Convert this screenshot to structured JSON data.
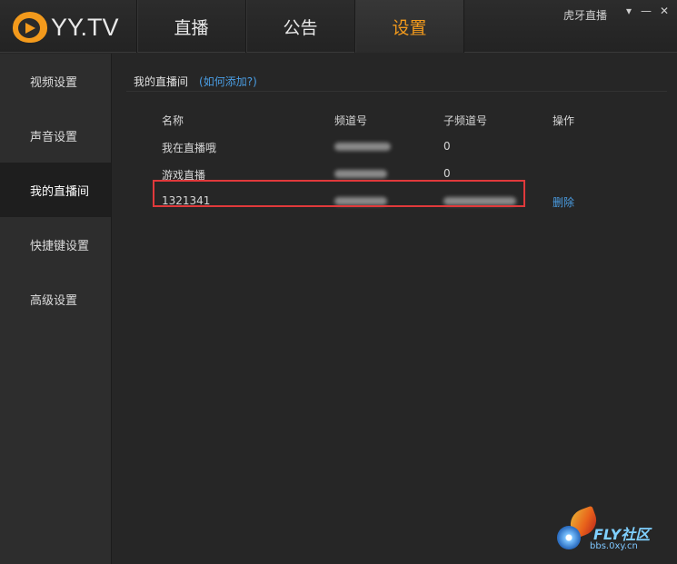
{
  "app": {
    "logo_text": "YY.TV",
    "label": "虎牙直播",
    "window_buttons": {
      "menu": "▾",
      "minimize": "—",
      "close": "✕"
    }
  },
  "tabs": [
    {
      "label": "直播",
      "active": false
    },
    {
      "label": "公告",
      "active": false
    },
    {
      "label": "设置",
      "active": true
    }
  ],
  "sidebar": {
    "items": [
      {
        "label": "视频设置"
      },
      {
        "label": "声音设置"
      },
      {
        "label": "我的直播间",
        "active": true
      },
      {
        "label": "快捷键设置"
      },
      {
        "label": "高级设置"
      }
    ]
  },
  "main": {
    "section_title": "我的直播间",
    "help_link": "(如何添加?)",
    "columns": [
      "名称",
      "频道号",
      "子频道号",
      "操作"
    ],
    "rows": [
      {
        "name": "我在直播哦",
        "channel": "",
        "subchannel": "0",
        "action": ""
      },
      {
        "name": "游戏直播",
        "channel": "",
        "subchannel": "0",
        "action": ""
      },
      {
        "name": "1321341",
        "channel": "",
        "subchannel": "",
        "action": "删除"
      }
    ]
  },
  "watermark": {
    "title": "FLY社区",
    "url": "bbs.0xy.cn"
  },
  "colors": {
    "accent": "#f39a1c",
    "link": "#4a9de3",
    "highlight_border": "#e0393b",
    "background": "#262626"
  }
}
